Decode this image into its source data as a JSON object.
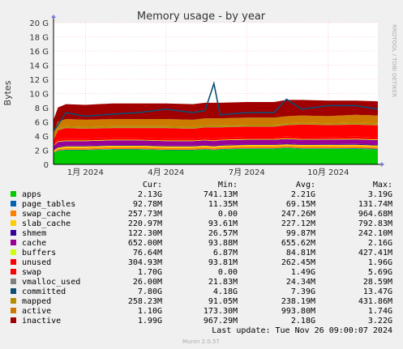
{
  "chart_data": {
    "type": "area",
    "title": "Memory usage - by year",
    "ylabel": "Bytes",
    "side_label": "RRDTOOL / TOBI OETIKER",
    "footer": "Munin 2.0.57",
    "last_update": "Last update:  Tue Nov 26 09:00:07 2024",
    "ylim": [
      0,
      20
    ],
    "yticks": [
      {
        "value": 0,
        "label": "0"
      },
      {
        "value": 2,
        "label": "2 G"
      },
      {
        "value": 4,
        "label": "4 G"
      },
      {
        "value": 6,
        "label": "6 G"
      },
      {
        "value": 8,
        "label": "8 G"
      },
      {
        "value": 10,
        "label": "10 G"
      },
      {
        "value": 12,
        "label": "12 G"
      },
      {
        "value": 14,
        "label": "14 G"
      },
      {
        "value": 16,
        "label": "16 G"
      },
      {
        "value": 18,
        "label": "18 G"
      },
      {
        "value": 20,
        "label": "20 G"
      }
    ],
    "xrange": [
      "2023-11-26",
      "2024-11-26"
    ],
    "xticks": [
      {
        "date": "2024-01-01",
        "label": "1月 2024"
      },
      {
        "date": "2024-04-01",
        "label": "4月 2024"
      },
      {
        "date": "2024-07-01",
        "label": "7月 2024"
      },
      {
        "date": "2024-10-01",
        "label": "10月 2024"
      }
    ],
    "x": [
      "2023-11-26",
      "2023-12-01",
      "2023-12-10",
      "2024-01-01",
      "2024-02-01",
      "2024-03-01",
      "2024-04-01",
      "2024-05-01",
      "2024-05-15",
      "2024-05-25",
      "2024-06-01",
      "2024-07-01",
      "2024-08-01",
      "2024-08-15",
      "2024-09-01",
      "2024-10-01",
      "2024-11-01",
      "2024-11-26"
    ],
    "columns": [
      "Cur:",
      "Min:",
      "Avg:",
      "Max:"
    ],
    "grid": true,
    "legend_position": "bottom",
    "series": [
      {
        "name": "apps",
        "color": "#00CC00",
        "cur": "2.13G",
        "min": "741.13M",
        "avg": "2.21G",
        "max": "3.19G",
        "values": [
          1.6,
          1.9,
          2.0,
          2.0,
          2.1,
          2.1,
          2.0,
          2.0,
          2.1,
          2.0,
          2.1,
          2.2,
          2.2,
          2.3,
          2.2,
          2.2,
          2.2,
          2.1
        ]
      },
      {
        "name": "page_tables",
        "color": "#0066B3",
        "cur": "92.78M",
        "min": "11.35M",
        "avg": "69.15M",
        "max": "131.74M",
        "values": [
          0.05,
          0.06,
          0.07,
          0.07,
          0.07,
          0.07,
          0.07,
          0.07,
          0.07,
          0.07,
          0.07,
          0.07,
          0.07,
          0.07,
          0.07,
          0.08,
          0.09,
          0.09
        ]
      },
      {
        "name": "swap_cache",
        "color": "#FF8000",
        "cur": "257.73M",
        "min": "0.00",
        "avg": "247.26M",
        "max": "964.68M",
        "values": [
          0.1,
          0.2,
          0.25,
          0.25,
          0.25,
          0.25,
          0.25,
          0.25,
          0.25,
          0.25,
          0.25,
          0.25,
          0.25,
          0.25,
          0.25,
          0.25,
          0.25,
          0.25
        ]
      },
      {
        "name": "slab_cache",
        "color": "#FFCC00",
        "cur": "220.97M",
        "min": "93.61M",
        "avg": "227.12M",
        "max": "792.83M",
        "values": [
          0.2,
          0.22,
          0.22,
          0.22,
          0.22,
          0.22,
          0.22,
          0.22,
          0.22,
          0.22,
          0.22,
          0.22,
          0.22,
          0.22,
          0.22,
          0.22,
          0.22,
          0.22
        ]
      },
      {
        "name": "shmem",
        "color": "#330099",
        "cur": "122.30M",
        "min": "26.57M",
        "avg": "99.87M",
        "max": "242.10M",
        "values": [
          0.05,
          0.1,
          0.1,
          0.1,
          0.1,
          0.1,
          0.1,
          0.1,
          0.1,
          0.1,
          0.1,
          0.1,
          0.1,
          0.1,
          0.1,
          0.1,
          0.12,
          0.12
        ]
      },
      {
        "name": "cache",
        "color": "#990099",
        "cur": "652.00M",
        "min": "93.88M",
        "avg": "655.62M",
        "max": "2.16G",
        "values": [
          0.6,
          0.7,
          0.65,
          0.65,
          0.65,
          0.65,
          0.65,
          0.65,
          0.65,
          0.65,
          0.65,
          0.65,
          0.65,
          0.65,
          0.65,
          0.65,
          0.65,
          0.65
        ]
      },
      {
        "name": "buffers",
        "color": "#CCFF00",
        "cur": "76.64M",
        "min": "6.87M",
        "avg": "84.81M",
        "max": "427.41M",
        "values": [
          0.05,
          0.08,
          0.08,
          0.08,
          0.08,
          0.08,
          0.08,
          0.08,
          0.08,
          0.08,
          0.08,
          0.08,
          0.08,
          0.08,
          0.08,
          0.08,
          0.08,
          0.08
        ]
      },
      {
        "name": "unused",
        "color": "#FF0000",
        "cur": "304.93M",
        "min": "93.81M",
        "avg": "262.45M",
        "max": "1.96G",
        "values": [
          0.2,
          0.25,
          0.26,
          0.26,
          0.26,
          0.26,
          0.26,
          0.26,
          0.26,
          0.26,
          0.26,
          0.26,
          0.26,
          0.26,
          0.26,
          0.26,
          0.3,
          0.3
        ]
      },
      {
        "name": "swap",
        "color": "#FF0000",
        "cur": "1.70G",
        "min": "0.00",
        "avg": "1.49G",
        "max": "5.69G",
        "values": [
          0.6,
          1.3,
          1.5,
          1.4,
          1.4,
          1.4,
          1.5,
          1.4,
          1.5,
          1.6,
          1.5,
          1.5,
          1.5,
          1.6,
          1.8,
          1.7,
          1.7,
          1.7
        ]
      },
      {
        "name": "vmalloc_used",
        "color": "#808080",
        "cur": "26.00M",
        "min": "21.83M",
        "avg": "24.34M",
        "max": "28.59M",
        "values": [
          0.03,
          0.03,
          0.03,
          0.03,
          0.03,
          0.03,
          0.03,
          0.03,
          0.03,
          0.03,
          0.03,
          0.03,
          0.03,
          0.03,
          0.03,
          0.03,
          0.03,
          0.03
        ]
      },
      {
        "name": "committed",
        "color": "#0C4E75",
        "cur": "7.80G",
        "min": "4.18G",
        "avg": "7.39G",
        "max": "13.47G",
        "values": [
          4.7,
          5.6,
          7.3,
          6.8,
          7.1,
          7.3,
          7.8,
          7.3,
          7.6,
          11.4,
          7.0,
          7.3,
          7.3,
          9.2,
          7.8,
          8.3,
          8.3,
          7.8
        ]
      },
      {
        "name": "mapped",
        "color": "#B38F00",
        "cur": "258.23M",
        "min": "91.05M",
        "avg": "238.19M",
        "max": "431.86M",
        "values": [
          0.2,
          0.24,
          0.24,
          0.24,
          0.24,
          0.24,
          0.24,
          0.24,
          0.24,
          0.24,
          0.24,
          0.24,
          0.24,
          0.24,
          0.24,
          0.24,
          0.26,
          0.26
        ]
      },
      {
        "name": "active",
        "color": "#CC7A00",
        "cur": "1.10G",
        "min": "173.30M",
        "avg": "993.80M",
        "max": "1.74G",
        "values": [
          0.8,
          0.95,
          1.0,
          1.0,
          1.0,
          1.0,
          1.0,
          1.0,
          1.0,
          1.0,
          1.0,
          1.0,
          1.0,
          1.0,
          1.0,
          1.0,
          1.1,
          1.1
        ]
      },
      {
        "name": "inactive",
        "color": "#A00000",
        "cur": "1.99G",
        "min": "967.29M",
        "avg": "2.18G",
        "max": "3.22G",
        "values": [
          1.8,
          2.0,
          2.1,
          2.1,
          2.2,
          2.2,
          2.2,
          2.2,
          2.2,
          2.2,
          2.2,
          2.2,
          2.2,
          2.3,
          2.2,
          2.2,
          2.0,
          2.0
        ]
      }
    ]
  }
}
